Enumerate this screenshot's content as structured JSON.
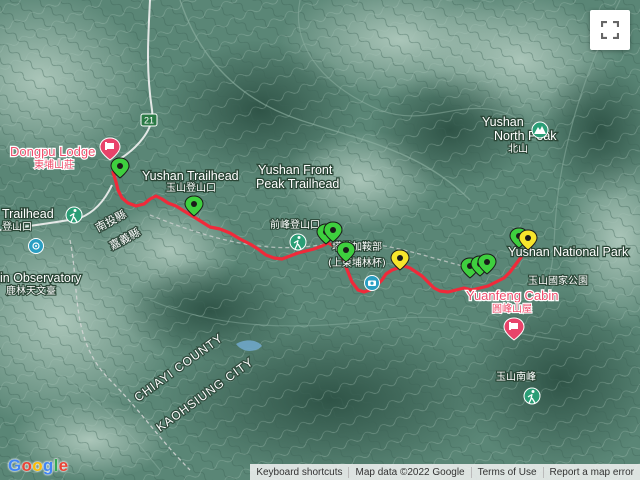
{
  "map": {
    "places": {
      "dongpu_en": "Dongpu Lodge",
      "dongpu_zh": "東埔山莊",
      "yushan_trailhead_en": "Yushan Trailhead",
      "yushan_trailhead_zh": "玉山登山口",
      "front_peak_en_1": "Yushan Front",
      "front_peak_en_2": "Peak Trailhead",
      "front_peak_zh": "前峰登山口",
      "trailhead_left_en": "Trailhead",
      "trailhead_left_zh": "登山口",
      "observatory_en": "in Observatory",
      "observatory_zh": "鹿林天文臺",
      "viewpoint_zh_1": "塔塔加鞍部",
      "viewpoint_zh_2": "(上東埔林杯)",
      "yushan_np_en": "Yushan National Park",
      "yushan_np_zh": "玉山國家公園",
      "north_peak_en": "Yushan",
      "north_peak_en_2": "North Peak",
      "north_peak_zh": "北山",
      "yuanfeng_en": "Yuanfeng Cabin",
      "yuanfeng_zh": "圓峰山屋",
      "south_peak_zh": "玉山南峰",
      "nantou_zh": "南投縣",
      "chiayi_zh": "嘉義縣",
      "chiayi_county": "CHIAYI COUNTY",
      "kaohsiung_city": "KAOHSIUNG CITY",
      "route_number": "21"
    },
    "colors": {
      "track": "#f02a3a",
      "pin_green": "#3ecf3e",
      "pin_yellow": "#f7e52c",
      "lodging_pin": "#e8436a",
      "poi_teal": "#2a9e76"
    }
  },
  "footer": {
    "keyboard_shortcuts": "Keyboard shortcuts",
    "map_data": "Map data ©2022 Google",
    "terms": "Terms of Use",
    "report": "Report a map error"
  },
  "logo": {
    "text": "Google"
  }
}
